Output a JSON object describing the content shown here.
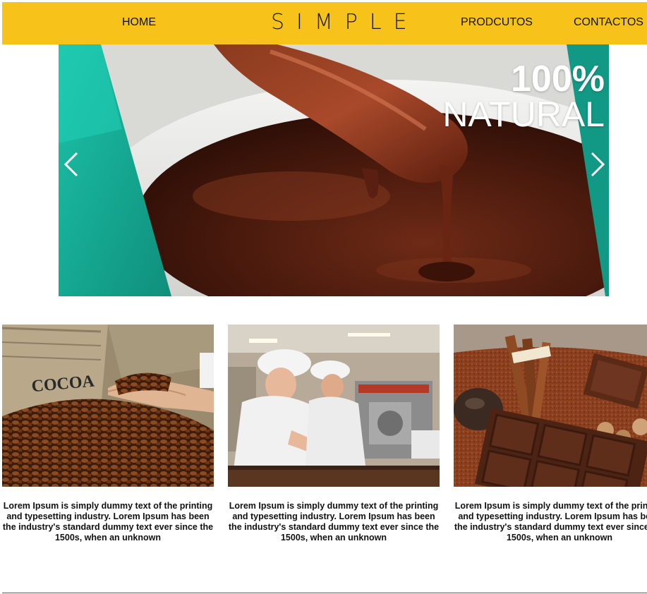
{
  "nav": {
    "home_label": "HOME",
    "logo_text": "SIMPLE",
    "products_label": "PRODCUTOS",
    "contact_label": "CONTACTOS"
  },
  "hero": {
    "headline_top": "100%",
    "headline_bottom": "NATURAL",
    "prev_icon": "chevron-left-icon",
    "next_icon": "chevron-right-icon"
  },
  "cards": [
    {
      "image": "cocoa-beans-photo",
      "text": "Lorem Ipsum is simply dummy text of the printing and typesetting industry. Lorem Ipsum has been the industry's standard dummy text ever since the 1500s, when an unknown"
    },
    {
      "image": "chocolate-factory-workers-photo",
      "text": "Lorem Ipsum is simply dummy text of the printing and typesetting industry. Lorem Ipsum has been the industry's standard dummy text ever since the 1500s, when an unknown"
    },
    {
      "image": "chocolate-bar-spices-photo",
      "text": "Lorem Ipsum is simply dummy text of the printing and typesetting industry. Lorem Ipsum has been the industry's standard dummy text ever since the 1500s, when an unknown"
    }
  ],
  "colors": {
    "navbar": "#f7c31a",
    "teal_accent": "#1aa892",
    "chocolate": "#5a1f10"
  }
}
